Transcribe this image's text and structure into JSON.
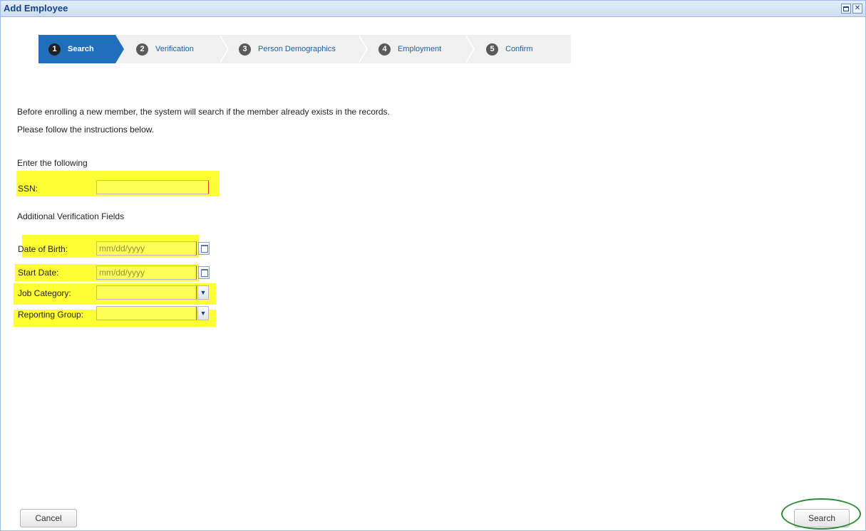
{
  "window": {
    "title": "Add Employee"
  },
  "wizard": {
    "steps": [
      {
        "number": "1",
        "label": "Search",
        "active": true
      },
      {
        "number": "2",
        "label": "Verification",
        "active": false
      },
      {
        "number": "3",
        "label": "Person Demographics",
        "active": false
      },
      {
        "number": "4",
        "label": "Employment",
        "active": false
      },
      {
        "number": "5",
        "label": "Confirm",
        "active": false
      }
    ]
  },
  "intro": {
    "line1": "Before enrolling a new member, the system will search if the member already exists in the records.",
    "line2": "Please follow the instructions below."
  },
  "form": {
    "section1_heading": "Enter the following",
    "ssn_label": "SSN:",
    "ssn_value": "",
    "section2_heading": "Additional Verification Fields",
    "dob_label": "Date of Birth:",
    "dob_placeholder": "mm/dd/yyyy",
    "start_label": "Start Date:",
    "start_placeholder": "mm/dd/yyyy",
    "job_label": "Job Category:",
    "job_value": "",
    "reporting_label": "Reporting Group:",
    "reporting_value": ""
  },
  "footer": {
    "cancel_label": "Cancel",
    "search_label": "Search"
  },
  "colors": {
    "highlight": "#ffff33",
    "accent_blue": "#1f6fbd",
    "title_blue": "#15428b",
    "annotation_green": "#2e8b3a"
  }
}
